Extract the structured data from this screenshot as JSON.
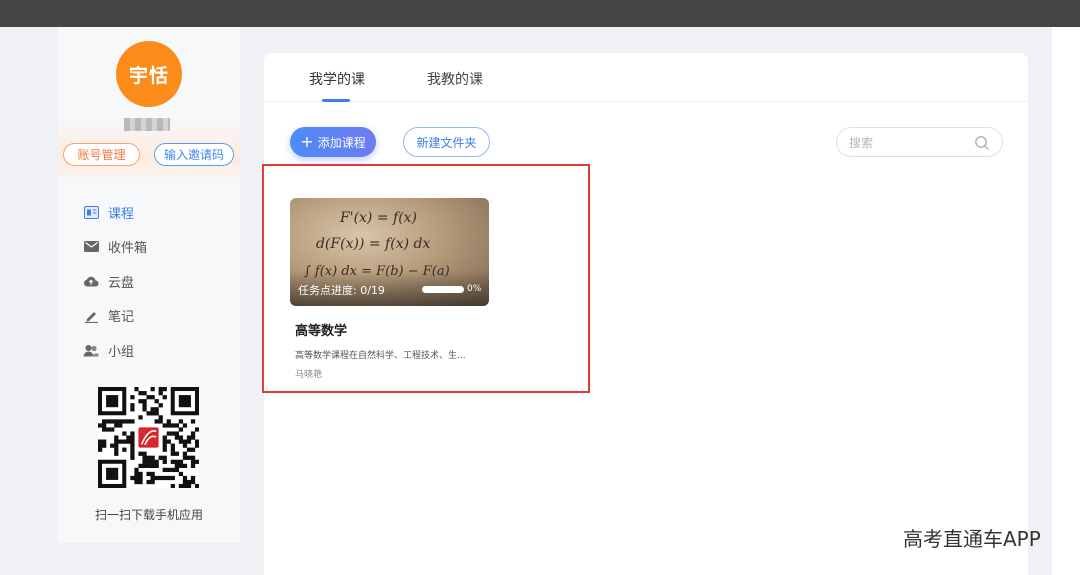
{
  "user": {
    "avatar_text": "宇恬",
    "account_button": "账号管理",
    "invite_button": "输入邀请码"
  },
  "sidebar": {
    "items": [
      {
        "label": "课程",
        "icon": "course-icon",
        "active": true
      },
      {
        "label": "收件箱",
        "icon": "mail-icon",
        "active": false
      },
      {
        "label": "云盘",
        "icon": "cloud-upload-icon",
        "active": false
      },
      {
        "label": "笔记",
        "icon": "note-pen-icon",
        "active": false
      },
      {
        "label": "小组",
        "icon": "group-icon",
        "active": false
      }
    ],
    "qr_caption": "扫一扫下载手机应用"
  },
  "tabs": [
    {
      "label": "我学的课",
      "active": true
    },
    {
      "label": "我教的课",
      "active": false
    }
  ],
  "toolbar": {
    "add_course_label": "添加课程",
    "new_folder_label": "新建文件夹",
    "search_placeholder": "搜索"
  },
  "course": {
    "title": "高等数学",
    "progress_label": "任务点进度: 0/19",
    "progress_percent_text": "0%",
    "progress_fraction": 0,
    "description": "高等数学课程在自然科学、工程技术、生...",
    "teacher": "马晓艳",
    "cover_formulas": [
      "F'(x) = f(x)",
      "d(F(x)) = f(x) dx",
      "∫ f(x) dx = F(b) − F(a)"
    ]
  },
  "colors": {
    "accent": "#3d7ef0",
    "avatar_bg": "#fb8c1b",
    "highlight_border": "#e53935"
  },
  "watermark": "高考直通车APP"
}
